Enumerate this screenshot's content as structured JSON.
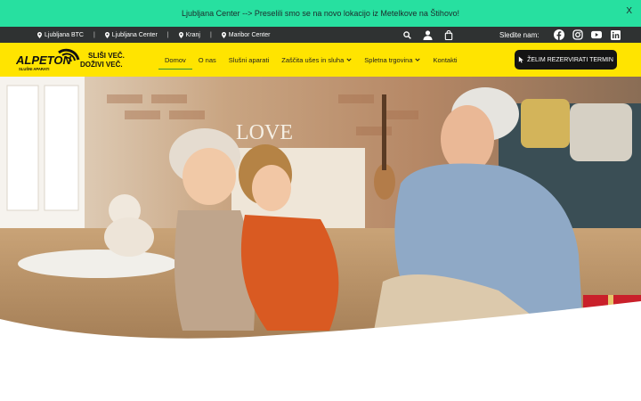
{
  "announcement": {
    "text": "Ljubljana Center --> Preselili smo se na novo lokacijo iz Metelkove na Štihovo!",
    "close_label": "X"
  },
  "topbar": {
    "locations": [
      "Ljubljana BTC",
      "Ljubljana Center",
      "Kranj",
      "Maribor Center"
    ],
    "separator": "|",
    "follow_label": "Sledite nam:",
    "socials": [
      "facebook-icon",
      "instagram-icon",
      "youtube-icon",
      "linkedin-icon"
    ]
  },
  "header": {
    "logo_text": "ALPETON",
    "logo_subtext": "SLUŠNI APARATI",
    "tagline_line1": "SLIŠI VEČ.",
    "tagline_line2": "DOŽIVI VEČ.",
    "nav": [
      {
        "label": "Domov",
        "active": true
      },
      {
        "label": "O nas"
      },
      {
        "label": "Slušni aparati"
      },
      {
        "label": "Zaščita ušes in sluha",
        "dropdown": true
      },
      {
        "label": "Spletna trgovina",
        "dropdown": true
      },
      {
        "label": "Kontakti"
      }
    ],
    "cta_label": "ŽELIM REZERVIRATI TERMIN"
  },
  "colors": {
    "announcement_bg": "#27e0a0",
    "topbar_bg": "#2f3232",
    "header_bg": "#ffe400",
    "cta_bg": "#141414",
    "nav_underline": "#2f8f3a"
  }
}
